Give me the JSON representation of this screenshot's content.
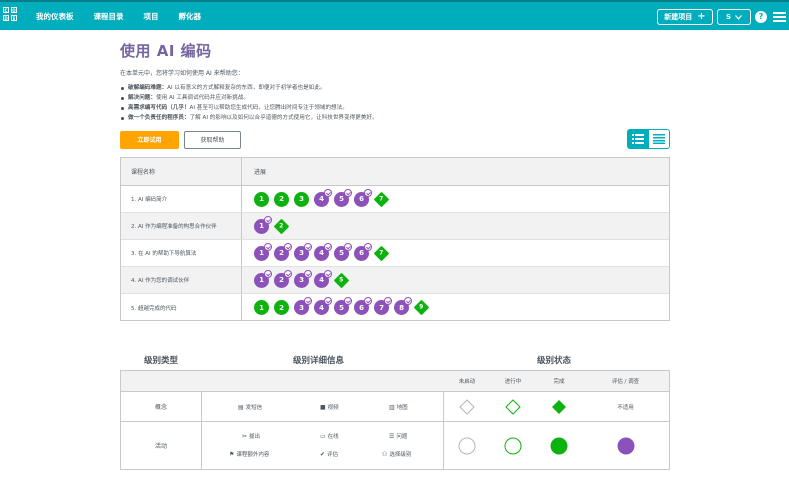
{
  "header": {
    "logo_letters": [
      "C",
      "O",
      "D",
      "E"
    ],
    "nav": [
      "我的仪表板",
      "课程目录",
      "项目",
      "孵化器"
    ],
    "new_project": "新建项目",
    "user_label": "S",
    "help": "?"
  },
  "page": {
    "title": "使用 AI 编码",
    "intro": "在本单元中，您将学习如何使用 AI 来帮助您：",
    "bullets": [
      {
        "bold": "破解编码难题：",
        "text": "AI 以有意义的方式解释复杂的东西，即便对于初学者也是如此。"
      },
      {
        "bold": "解决问题：",
        "text": "使用 AI 工具调试代码并应对新挑战。"
      },
      {
        "bold": "高需求编写代码（几乎！",
        "text": "AI 甚至可以帮助您生成代码，让您腾出时间专注于领域的想法。"
      },
      {
        "bold": "做一个负责任的程序员：",
        "text": "了解 AI 的影响以及如何以合乎道德的方式使用它，让科技世界变得更美好。"
      }
    ],
    "try_now": "立即试用",
    "get_help": "获取帮助"
  },
  "progress_table": {
    "col_name": "课程名称",
    "col_progress": "进展",
    "lessons": [
      {
        "name": "1. AI 编码简介",
        "levels": [
          {
            "n": "1",
            "t": "g"
          },
          {
            "n": "2",
            "t": "g"
          },
          {
            "n": "3",
            "t": "g"
          },
          {
            "n": "4",
            "t": "p"
          },
          {
            "n": "5",
            "t": "p"
          },
          {
            "n": "6",
            "t": "p"
          },
          {
            "n": "7",
            "t": "d"
          }
        ]
      },
      {
        "name": "2. AI 作为编程准备的构思合作伙伴",
        "levels": [
          {
            "n": "1",
            "t": "p"
          },
          {
            "n": "2",
            "t": "d"
          }
        ]
      },
      {
        "name": "3. 在 AI 的帮助下导航算法",
        "levels": [
          {
            "n": "1",
            "t": "p"
          },
          {
            "n": "2",
            "t": "p"
          },
          {
            "n": "3",
            "t": "p"
          },
          {
            "n": "4",
            "t": "p"
          },
          {
            "n": "5",
            "t": "p"
          },
          {
            "n": "6",
            "t": "p"
          },
          {
            "n": "7",
            "t": "d"
          }
        ]
      },
      {
        "name": "4. AI 作为您的调试伙伴",
        "levels": [
          {
            "n": "1",
            "t": "p"
          },
          {
            "n": "2",
            "t": "p"
          },
          {
            "n": "3",
            "t": "p"
          },
          {
            "n": "4",
            "t": "p"
          },
          {
            "n": "5",
            "t": "d"
          }
        ]
      },
      {
        "name": "5. 超越完成的代码",
        "levels": [
          {
            "n": "1",
            "t": "g"
          },
          {
            "n": "2",
            "t": "g"
          },
          {
            "n": "3",
            "t": "p"
          },
          {
            "n": "4",
            "t": "p"
          },
          {
            "n": "5",
            "t": "p"
          },
          {
            "n": "6",
            "t": "p"
          },
          {
            "n": "7",
            "t": "p"
          },
          {
            "n": "8",
            "t": "p"
          },
          {
            "n": "9",
            "t": "d"
          }
        ]
      }
    ]
  },
  "legend": {
    "head_type": "级别类型",
    "head_details": "级别详细信息",
    "head_status": "级别状态",
    "status_cols": [
      "未启动",
      "进行中",
      "完成",
      "评估 / 调查"
    ],
    "concept": {
      "label": "概念",
      "details": [
        "发短信",
        "视频",
        "地图"
      ],
      "na": "不适用"
    },
    "activity": {
      "label": "活动",
      "details": [
        "拔出",
        "在线",
        "问题",
        "课程额外内容",
        "评估",
        "选择级别"
      ]
    }
  },
  "colors": {
    "teal": "#00adbc",
    "green": "#0eb20e",
    "purple": "#8c52ba",
    "orange": "#ffa400",
    "title": "#7665a0"
  }
}
